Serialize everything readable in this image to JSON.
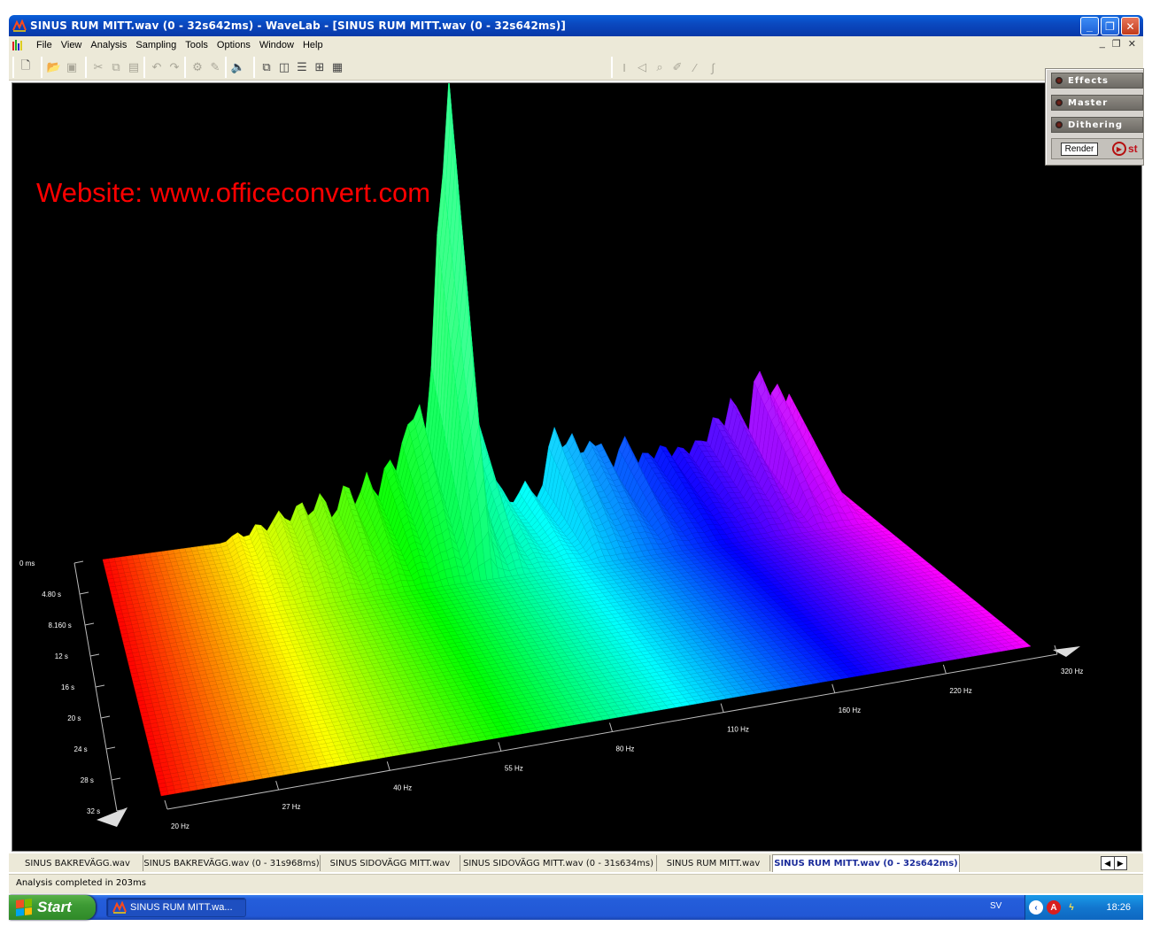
{
  "window": {
    "title": "SINUS RUM MITT.wav (0 - 32s642ms) - WaveLab - [SINUS RUM MITT.wav (0 - 32s642ms)]",
    "minimize_label": "_",
    "maximize_label": "❐",
    "close_label": "✕"
  },
  "menu": {
    "items": [
      "File",
      "View",
      "Analysis",
      "Sampling",
      "Tools",
      "Options",
      "Window",
      "Help"
    ],
    "mdi_minimize": "_",
    "mdi_restore": "❐",
    "mdi_close": "✕"
  },
  "watermark": "Website: www.officeconvert.com",
  "master_section": {
    "effects_label": "Effects",
    "master_label": "Master",
    "dithering_label": "Dithering",
    "render_label": "Render",
    "play_label": "st"
  },
  "chart_data": {
    "type": "3d-spectrum-waterfall",
    "frequency_axis": {
      "tick_labels": [
        "20 Hz",
        "27 Hz",
        "40 Hz",
        "55 Hz",
        "80 Hz",
        "110 Hz",
        "160 Hz",
        "220 Hz",
        "320 Hz"
      ]
    },
    "time_axis": {
      "tick_labels": [
        "0 ms",
        "4.80 s",
        "8.160 s",
        "12 s",
        "16 s",
        "20 s",
        "24 s",
        "28 s",
        "32 s"
      ]
    },
    "color_scale": "rainbow (red at 20 Hz to magenta at 320 Hz)"
  },
  "tabs": [
    {
      "label": "SINUS BAKREVÄGG.wav",
      "active": false
    },
    {
      "label": "SINUS BAKREVÄGG.wav (0 - 31s968ms)",
      "active": false
    },
    {
      "label": "SINUS SIDOVÄGG MITT.wav",
      "active": false
    },
    {
      "label": "SINUS SIDOVÄGG MITT.wav (0 - 31s634ms)",
      "active": false
    },
    {
      "label": "SINUS RUM MITT.wav",
      "active": false
    },
    {
      "label": "SINUS RUM MITT.wav (0 - 32s642ms)",
      "active": true
    }
  ],
  "status": "Analysis completed in 203ms",
  "taskbar": {
    "start_label": "Start",
    "task_label": "SINUS RUM MITT.wa...",
    "language": "SV",
    "clock": "18:26"
  }
}
